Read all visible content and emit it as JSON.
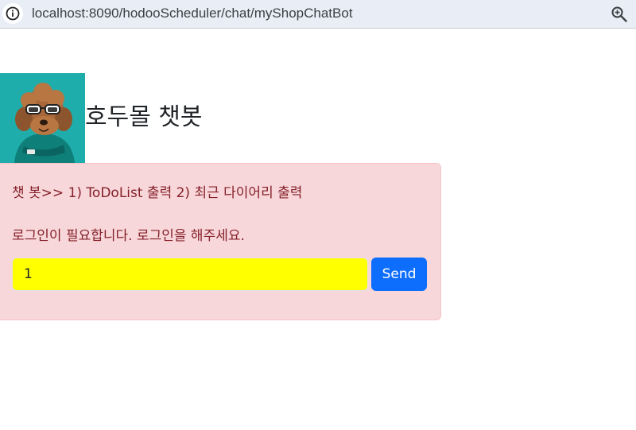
{
  "browser": {
    "url": "localhost:8090/hodooScheduler/chat/myShopChatBot",
    "info_icon": "info-icon",
    "zoom_icon": "zoom-icon"
  },
  "header": {
    "logo_alt": "dog-with-sunglasses-image",
    "title": "호두몰 챗봇"
  },
  "chat": {
    "messages": [
      "챗 봇>> 1) ToDoList 출력 2) 최근 다이어리 출력",
      "로그인이 필요합니다. 로그인을 해주세요."
    ],
    "input_value": "1",
    "send_label": "Send"
  },
  "colors": {
    "alert_bg": "#f8d7da",
    "alert_text": "#842029",
    "input_bg": "#ffff00",
    "button_bg": "#0d6efd",
    "logo_bg": "#19a7a6"
  }
}
